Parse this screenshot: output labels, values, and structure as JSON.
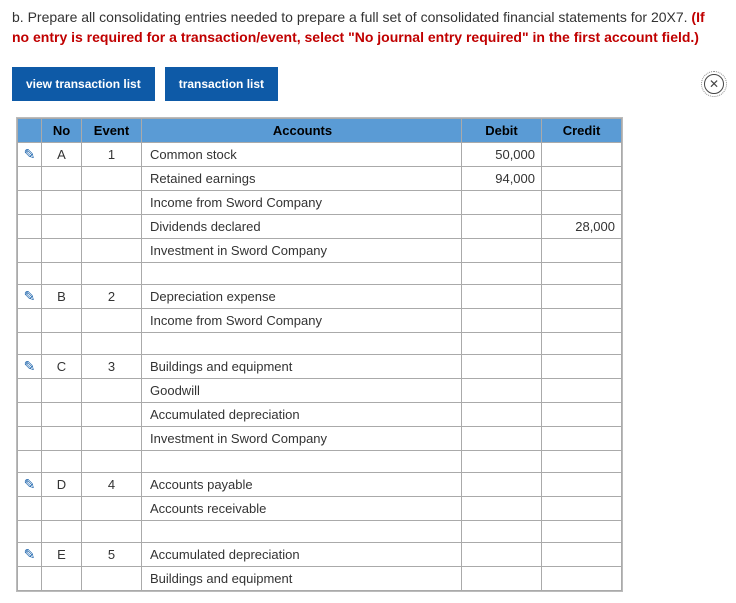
{
  "prompt_prefix": "b. Prepare all consolidating entries needed to prepare a full set of consolidated financial statements for 20X7. ",
  "prompt_red": "(If no entry is required for a transaction/event, select \"No journal entry required\" in the first account field.)",
  "buttons": {
    "view_list": "view transaction list",
    "txn_list": "transaction list"
  },
  "headers": {
    "edit": "",
    "no": "No",
    "event": "Event",
    "accounts": "Accounts",
    "debit": "Debit",
    "credit": "Credit"
  },
  "rows": [
    {
      "edit": true,
      "no": "A",
      "event": "1",
      "account": "Common stock",
      "debit": "50,000",
      "credit": ""
    },
    {
      "edit": false,
      "no": "",
      "event": "",
      "account": "Retained earnings",
      "debit": "94,000",
      "credit": ""
    },
    {
      "edit": false,
      "no": "",
      "event": "",
      "account": "Income from Sword Company",
      "debit": "",
      "credit": ""
    },
    {
      "edit": false,
      "no": "",
      "event": "",
      "account": "Dividends declared",
      "indent": true,
      "debit": "",
      "credit": "28,000"
    },
    {
      "edit": false,
      "no": "",
      "event": "",
      "account": "Investment in Sword Company",
      "debit": "",
      "credit": ""
    },
    {
      "edit": false,
      "no": "",
      "event": "",
      "account": "",
      "debit": "",
      "credit": ""
    },
    {
      "edit": true,
      "no": "B",
      "event": "2",
      "account": "Depreciation expense",
      "debit": "",
      "credit": ""
    },
    {
      "edit": false,
      "no": "",
      "event": "",
      "account": "Income from Sword Company",
      "debit": "",
      "credit": ""
    },
    {
      "edit": false,
      "no": "",
      "event": "",
      "account": "",
      "debit": "",
      "credit": ""
    },
    {
      "edit": true,
      "no": "C",
      "event": "3",
      "account": "Buildings and equipment",
      "debit": "",
      "credit": ""
    },
    {
      "edit": false,
      "no": "",
      "event": "",
      "account": "Goodwill",
      "debit": "",
      "credit": ""
    },
    {
      "edit": false,
      "no": "",
      "event": "",
      "account": "Accumulated depreciation",
      "debit": "",
      "credit": ""
    },
    {
      "edit": false,
      "no": "",
      "event": "",
      "account": "Investment in Sword Company",
      "debit": "",
      "credit": ""
    },
    {
      "edit": false,
      "no": "",
      "event": "",
      "account": "",
      "debit": "",
      "credit": ""
    },
    {
      "edit": true,
      "no": "D",
      "event": "4",
      "account": "Accounts payable",
      "debit": "",
      "credit": ""
    },
    {
      "edit": false,
      "no": "",
      "event": "",
      "account": "Accounts receivable",
      "debit": "",
      "credit": ""
    },
    {
      "edit": false,
      "no": "",
      "event": "",
      "account": "",
      "debit": "",
      "credit": ""
    },
    {
      "edit": true,
      "no": "E",
      "event": "5",
      "account": "Accumulated depreciation",
      "debit": "",
      "credit": ""
    },
    {
      "edit": false,
      "no": "",
      "event": "",
      "account": "Buildings and equipment",
      "debit": "",
      "credit": ""
    }
  ]
}
